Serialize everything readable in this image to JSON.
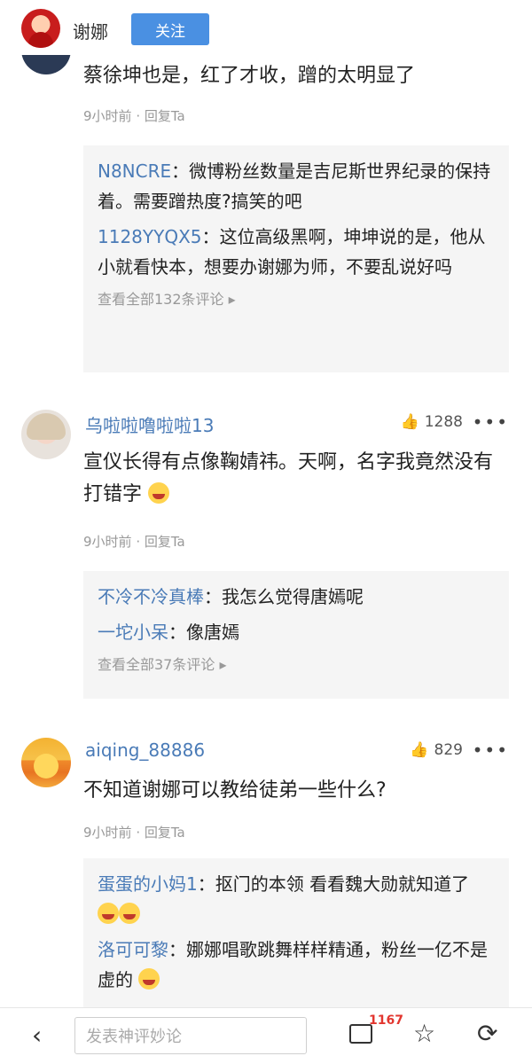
{
  "header": {
    "name": "谢娜",
    "follow": "关注"
  },
  "comment0": {
    "text": "蔡徐坤也是，红了才收，蹭的太明显了",
    "time": "9小时前",
    "reply_label": "回复Ta",
    "replies": [
      {
        "name": "N8NCRE",
        "text": "：微博粉丝数量是吉尼斯世界纪录的保持着。需要蹭热度?搞笑的吧"
      },
      {
        "name": "1128YYQX5",
        "text": "：这位高级黑啊，坤坤说的是，他从小就看快本，想要办谢娜为师，不要乱说好吗"
      }
    ],
    "view_all": "查看全部132条评论 ▸"
  },
  "comment1": {
    "name": "乌啦啦噜啦啦13",
    "likes": "1288",
    "text": "宣仪长得有点像鞠婧祎。天啊，名字我竟然没有打错字",
    "time": "9小时前",
    "reply_label": "回复Ta",
    "replies": [
      {
        "name": "不冷不冷真棒",
        "text": "：我怎么觉得唐嫣呢"
      },
      {
        "name": "一坨小呆",
        "text": "：像唐嫣"
      }
    ],
    "view_all": "查看全部37条评论 ▸"
  },
  "comment2": {
    "name": "aiqing_88886",
    "likes": "829",
    "text": "不知道谢娜可以教给徒弟一些什么?",
    "time": "9小时前",
    "reply_label": "回复Ta",
    "replies": [
      {
        "name": "蛋蛋的小妈1",
        "text": "：抠门的本领 看看魏大勋就知道了"
      },
      {
        "name": "洛可可黎",
        "text": "：娜娜唱歌跳舞样样精通，粉丝一亿不是虚的"
      }
    ]
  },
  "bottom": {
    "placeholder": "发表神评妙论",
    "comment_count": "1167",
    "back_icon": "chevron-left-icon",
    "comment_icon": "comment-icon",
    "star_icon": "star-icon",
    "share_icon": "share-icon"
  }
}
